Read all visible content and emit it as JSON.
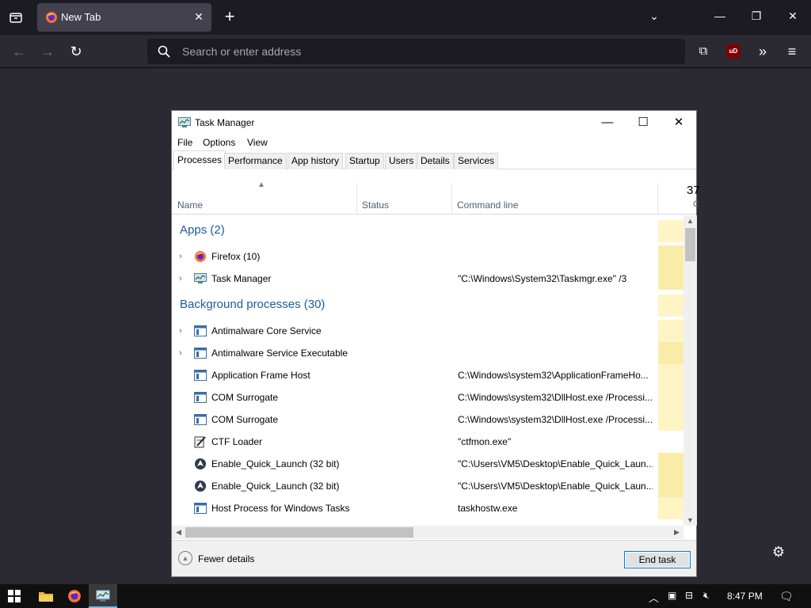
{
  "browser": {
    "tab_title": "New Tab",
    "address_placeholder": "Search or enter address",
    "ublock_label": "uD"
  },
  "task_manager": {
    "title": "Task Manager",
    "menu": [
      "File",
      "Options",
      "View"
    ],
    "tabs": [
      "Processes",
      "Performance",
      "App history",
      "Startup",
      "Users",
      "Details",
      "Services"
    ],
    "columns": {
      "name": "Name",
      "status": "Status",
      "command_line": "Command line",
      "cpu_percent": "37",
      "cpu_sub": "C"
    },
    "groups": {
      "apps": "Apps (2)",
      "background": "Background processes (30)"
    },
    "rows": [
      {
        "name": "Firefox (10)",
        "cmd": "",
        "expandable": true,
        "icon": "firefox-icon"
      },
      {
        "name": "Task Manager",
        "cmd": "\"C:\\Windows\\System32\\Taskmgr.exe\" /3",
        "expandable": true,
        "icon": "task-manager-icon"
      },
      {
        "name": "Antimalware Core Service",
        "cmd": "",
        "expandable": true,
        "icon": "service-window-icon"
      },
      {
        "name": "Antimalware Service Executable",
        "cmd": "",
        "expandable": true,
        "icon": "service-window-icon"
      },
      {
        "name": "Application Frame Host",
        "cmd": "C:\\Windows\\system32\\ApplicationFrameHo...",
        "expandable": false,
        "icon": "service-window-icon"
      },
      {
        "name": "COM Surrogate",
        "cmd": "C:\\Windows\\system32\\DllHost.exe /Processi...",
        "expandable": false,
        "icon": "service-window-icon"
      },
      {
        "name": "COM Surrogate",
        "cmd": "C:\\Windows\\system32\\DllHost.exe /Processi...",
        "expandable": false,
        "icon": "service-window-icon"
      },
      {
        "name": "CTF Loader",
        "cmd": "\"ctfmon.exe\"",
        "expandable": false,
        "icon": "ctf-loader-icon"
      },
      {
        "name": "Enable_Quick_Launch (32 bit)",
        "cmd": "\"C:\\Users\\VM5\\Desktop\\Enable_Quick_Laun...",
        "expandable": false,
        "icon": "launch-icon"
      },
      {
        "name": "Enable_Quick_Launch (32 bit)",
        "cmd": "\"C:\\Users\\VM5\\Desktop\\Enable_Quick_Laun...",
        "expandable": false,
        "icon": "launch-icon"
      },
      {
        "name": "Host Process for Windows Tasks",
        "cmd": "taskhostw.exe",
        "expandable": false,
        "icon": "service-window-icon"
      }
    ],
    "footer": {
      "fewer_details": "Fewer details",
      "end_task": "End task"
    }
  },
  "taskbar": {
    "time": "8:47 PM"
  },
  "colors": {
    "group_heading": "#1e5aa0",
    "cpu_heat_light": "#fff4c4",
    "cpu_heat_medium": "#f9eca8",
    "end_task_border": "#0078d7"
  }
}
